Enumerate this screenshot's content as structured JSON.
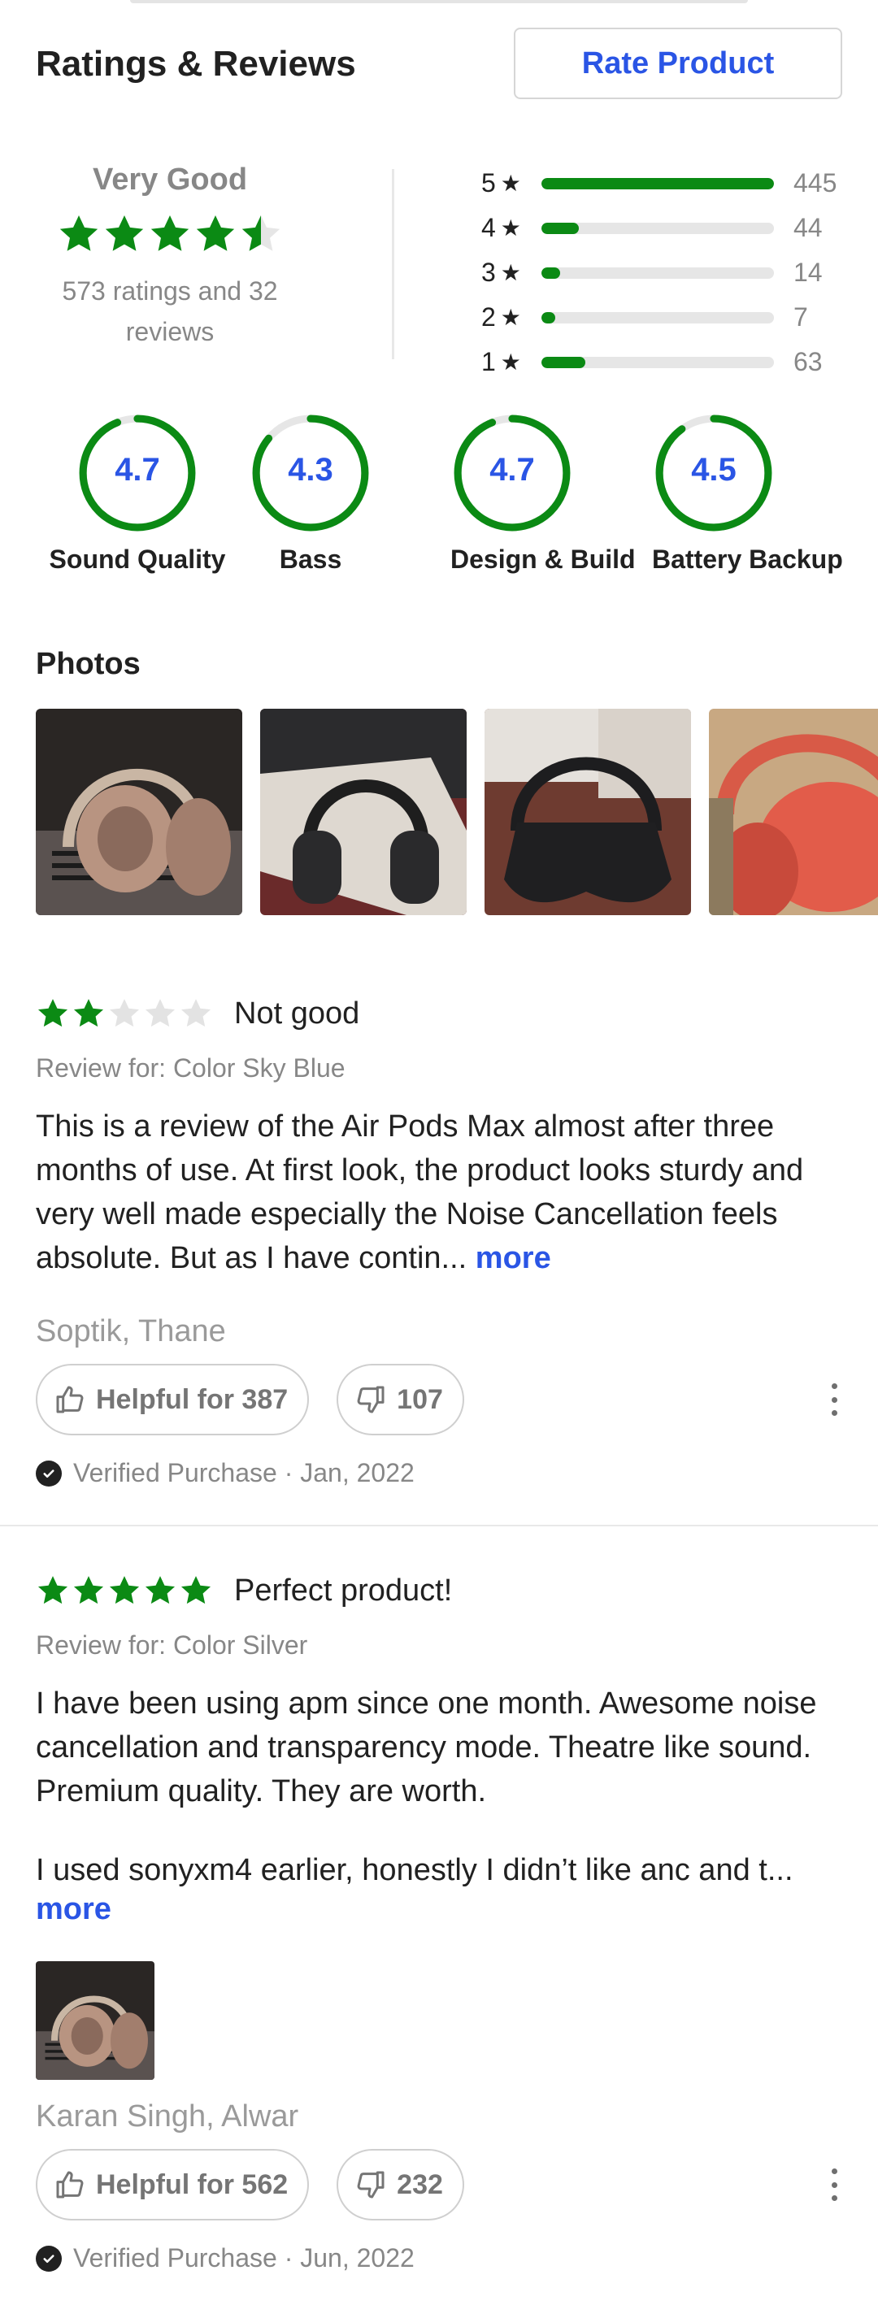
{
  "header": {
    "title": "Ratings & Reviews",
    "rate_button": "Rate Product"
  },
  "summary": {
    "verdict": "Very Good",
    "stars": 4.5,
    "count_text": "573 ratings and 32 reviews",
    "distribution": [
      {
        "label": "5",
        "count": "445",
        "fraction": 1.0
      },
      {
        "label": "4",
        "count": "44",
        "fraction": 0.16
      },
      {
        "label": "3",
        "count": "14",
        "fraction": 0.08
      },
      {
        "label": "2",
        "count": "7",
        "fraction": 0.06
      },
      {
        "label": "1",
        "count": "63",
        "fraction": 0.19
      }
    ]
  },
  "aspects": [
    {
      "value": "4.7",
      "name": "Sound Quality",
      "fraction": 0.94
    },
    {
      "value": "4.3",
      "name": "Bass",
      "fraction": 0.86
    },
    {
      "value": "4.7",
      "name": "Design & Build",
      "fraction": 0.94
    },
    {
      "value": "4.5",
      "name": "Battery Backup",
      "fraction": 0.9
    }
  ],
  "photos": {
    "title": "Photos"
  },
  "reviews": [
    {
      "rating": 2,
      "title": "Not good",
      "review_for": "Review for: Color Sky Blue",
      "body": "This is a review of the Air Pods Max almost after three months of use. At first look, the product looks sturdy and very well made especially the Noise Cancellation feels absolute. But as I have contin...",
      "more": "more",
      "author": "Soptik, Thane",
      "helpful": "Helpful for 387",
      "unhelpful": "107",
      "verified": "Verified Purchase · Jan, 2022"
    },
    {
      "rating": 5,
      "title": "Perfect product!",
      "review_for": "Review for: Color Silver",
      "body_p1": "I have been using apm since one month. Awesome noise cancellation and transparency mode. Theatre like sound. Premium quality. They are worth.",
      "body_p2": "I used sonyxm4 earlier, honestly I didn’t like anc and t...",
      "more": "more",
      "author": "Karan Singh, Alwar",
      "helpful": "Helpful for 562",
      "unhelpful": "232",
      "verified": "Verified Purchase · Jun, 2022"
    }
  ],
  "colors": {
    "accent": "#2a55e5",
    "star_green": "#0b8a14",
    "muted": "#878787"
  }
}
